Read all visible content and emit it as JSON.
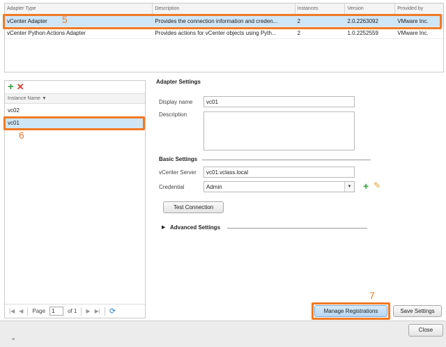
{
  "adapter_table": {
    "columns": [
      "Adapter Type",
      "Description",
      "Instances",
      "Version",
      "Provided by"
    ],
    "rows": [
      {
        "type": "vCenter Adapter",
        "description": "Provides the connection information and creden...",
        "instances": "2",
        "version": "2.0.2263092",
        "provider": "VMware Inc.",
        "selected": true
      },
      {
        "type": "vCenter Python Actions Adapter",
        "description": "Provides actions for vCenter objects using Pyth...",
        "instances": "2",
        "version": "1.0.2252559",
        "provider": "VMware Inc.",
        "selected": false
      }
    ]
  },
  "callouts": {
    "five": "5",
    "six": "6",
    "seven": "7",
    "color": "#f07a25"
  },
  "instances_panel": {
    "column_header": "Instance Name",
    "items": [
      {
        "label": "vc02",
        "selected": false
      },
      {
        "label": "vc01",
        "selected": true
      }
    ],
    "pager": {
      "page_label": "Page",
      "page_value": "1",
      "of_label": "of 1"
    }
  },
  "adapter_settings": {
    "title": "Adapter Settings",
    "display_name_label": "Display name",
    "display_name_value": "vc01",
    "description_label": "Description",
    "basic_settings_title": "Basic Settings",
    "vcenter_server_label": "vCenter Server",
    "vcenter_server_value": "vc01.vclass.local",
    "credential_label": "Credential",
    "credential_value": "Admin",
    "test_connection_label": "Test Connection",
    "advanced_settings_title": "Advanced Settings"
  },
  "actions": {
    "manage_registrations_label": "Manage Registrations",
    "save_settings_label": "Save Settings",
    "close_label": "Close"
  },
  "colors": {
    "selection": "#cfe6f7",
    "add": "#2fa33b",
    "delete": "#d43a2c",
    "accent": "#f07a25"
  }
}
